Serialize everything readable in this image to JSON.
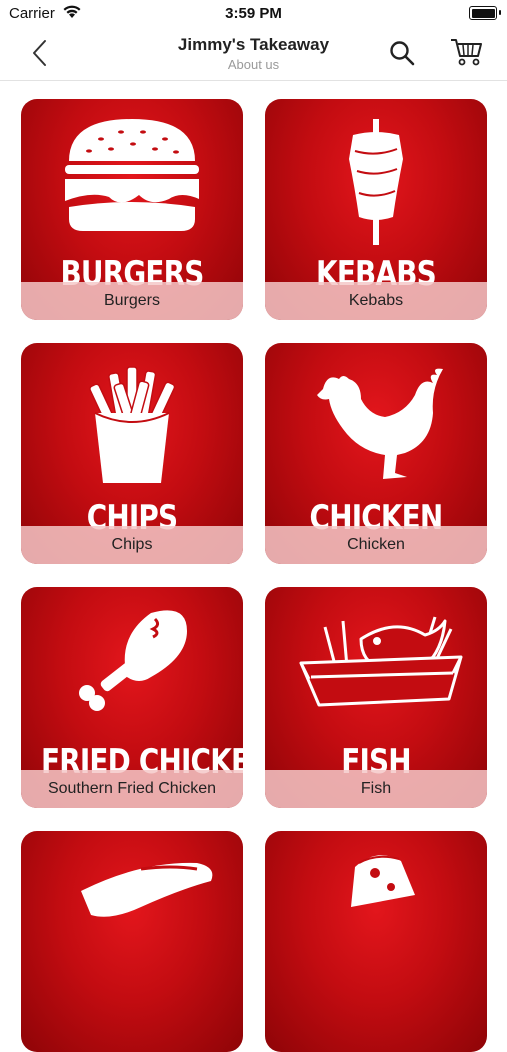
{
  "status_bar": {
    "carrier": "Carrier",
    "time": "3:59 PM"
  },
  "nav": {
    "title": "Jimmy's Takeaway",
    "subtitle": "About us"
  },
  "icons": {
    "back": "chevron-left-icon",
    "search": "search-icon",
    "cart": "cart-icon"
  },
  "colors": {
    "tile_red": "#c30c11",
    "caption_bg": "#f5c8c8"
  },
  "categories": [
    {
      "title": "BURGERS",
      "label": "Burgers",
      "icon": "burger-icon"
    },
    {
      "title": "KEBABS",
      "label": "Kebabs",
      "icon": "kebab-icon"
    },
    {
      "title": "CHIPS",
      "label": "Chips",
      "icon": "fries-icon"
    },
    {
      "title": "CHICKEN",
      "label": "Chicken",
      "icon": "chicken-icon"
    },
    {
      "title": "FRIED CHICKEN",
      "label": "Southern Fried Chicken",
      "icon": "drumstick-icon"
    },
    {
      "title": "FISH",
      "label": "Fish",
      "icon": "fish-and-chips-icon"
    },
    {
      "title": "",
      "label": "",
      "icon": "hotdog-icon"
    },
    {
      "title": "",
      "label": "",
      "icon": "pizza-icon"
    }
  ]
}
